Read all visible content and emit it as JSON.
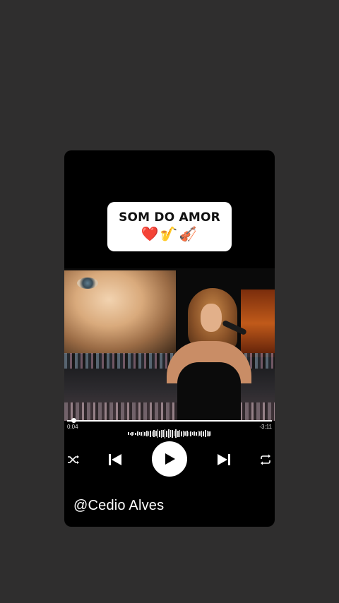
{
  "title": {
    "text": "SOM DO AMOR",
    "emoji": "❤️🎷🎻"
  },
  "player": {
    "elapsed": "0:04",
    "remaining": "-3:11",
    "progress_fraction": 0.03
  },
  "controls": {
    "shuffle_icon": "shuffle-icon",
    "previous_icon": "skip-previous-icon",
    "play_icon": "play-icon",
    "next_icon": "skip-next-icon",
    "repeat_icon": "repeat-icon"
  },
  "user": {
    "handle": "@Cedio Alves"
  },
  "colors": {
    "background": "#2f2e2e",
    "card": "#000000",
    "accent": "#ffffff"
  }
}
